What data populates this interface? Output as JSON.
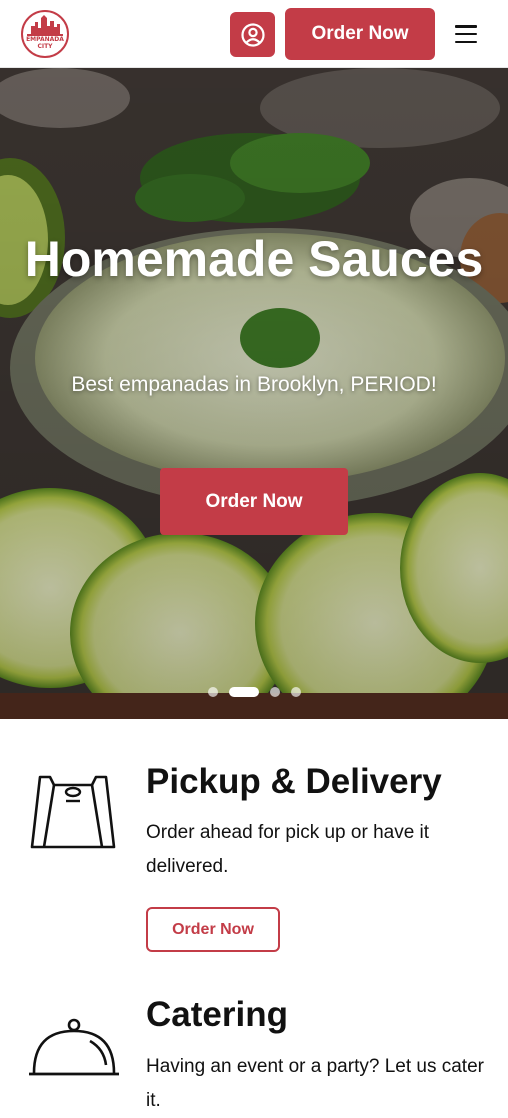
{
  "header": {
    "logo_line1": "EMPANADA",
    "logo_line2": "CITY",
    "order_label": "Order Now"
  },
  "hero": {
    "title": "Homemade Sauces",
    "subtitle": "Best empanadas in Brooklyn, PERIOD!",
    "button_label": "Order Now",
    "carousel": {
      "slides": 4,
      "active_index": 1
    }
  },
  "features": [
    {
      "icon": "bag-icon",
      "title": "Pickup & Delivery",
      "description": "Order ahead for pick up or have it delivered.",
      "button_label": "Order Now"
    },
    {
      "icon": "cloche-icon",
      "title": "Catering",
      "description": "Having an event or a party? Let us cater it."
    }
  ],
  "colors": {
    "brand": "#c33c47",
    "text": "#111111",
    "background": "#ffffff"
  }
}
